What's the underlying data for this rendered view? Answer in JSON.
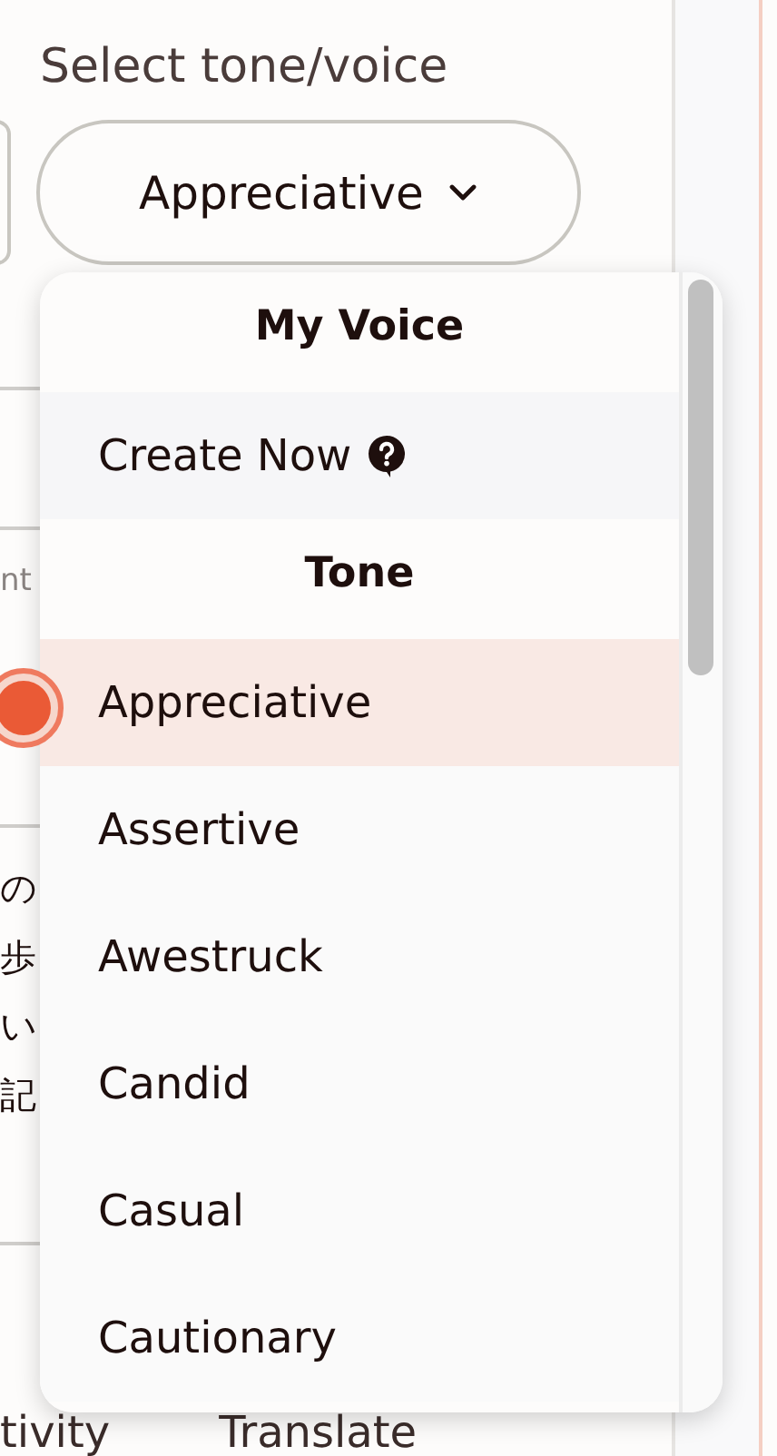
{
  "field": {
    "label": "Select tone/voice",
    "value": "Appreciative"
  },
  "background": {
    "column_text": "nt",
    "radio": {
      "selected": true
    },
    "lines": [
      "の",
      "歩",
      "い",
      "記"
    ],
    "bottom_tabs": [
      "tivity",
      "Translate"
    ]
  },
  "menu": {
    "sections": [
      {
        "header": "My Voice",
        "items": [
          {
            "label": "Create Now",
            "kind": "help",
            "selected": false
          }
        ]
      },
      {
        "header": "Tone",
        "items": [
          {
            "label": "Appreciative",
            "kind": "option",
            "selected": true
          },
          {
            "label": "Assertive",
            "kind": "option",
            "selected": false
          },
          {
            "label": "Awestruck",
            "kind": "option",
            "selected": false
          },
          {
            "label": "Candid",
            "kind": "option",
            "selected": false
          },
          {
            "label": "Casual",
            "kind": "option",
            "selected": false
          },
          {
            "label": "Cautionary",
            "kind": "option",
            "selected": false
          }
        ]
      }
    ]
  }
}
